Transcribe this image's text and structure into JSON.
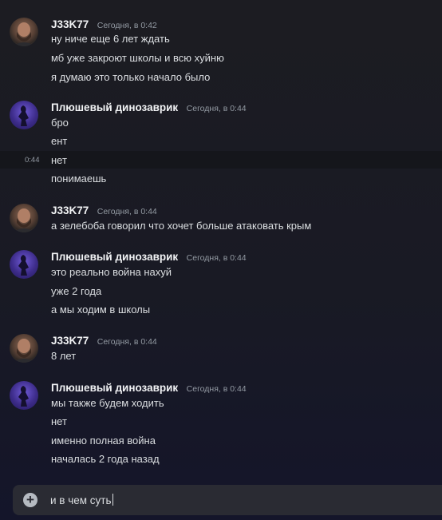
{
  "messages": [
    {
      "author": "J33K77",
      "timestamp": "Сегодня, в 0:42",
      "avatar": "bearded-man-avatar",
      "lines": [
        "ну ниче еще 6 лет ждать",
        "мб уже закроют школы и всю хуйню",
        "я думаю это только начало было"
      ]
    },
    {
      "author": "Плюшевый динозаврик",
      "timestamp": "Сегодня, в 0:44",
      "avatar": "purple-silhouette-avatar",
      "lines": [
        "бро",
        "ент",
        "нет",
        "понимаешь"
      ],
      "hovered_line_time": "0:44"
    },
    {
      "author": "J33K77",
      "timestamp": "Сегодня, в 0:44",
      "avatar": "bearded-man-avatar",
      "lines": [
        "а зелебоба говорил что хочет больше атаковать крым"
      ]
    },
    {
      "author": "Плюшевый динозаврик",
      "timestamp": "Сегодня, в 0:44",
      "avatar": "purple-silhouette-avatar",
      "lines": [
        "это реально война нахуй",
        "уже 2 года",
        "а мы ходим в школы"
      ]
    },
    {
      "author": "J33K77",
      "timestamp": "Сегодня, в 0:44",
      "avatar": "bearded-man-avatar",
      "lines": [
        "8 лет"
      ]
    },
    {
      "author": "Плюшевый динозаврик",
      "timestamp": "Сегодня, в 0:44",
      "avatar": "purple-silhouette-avatar",
      "lines": [
        "мы также будем ходить",
        "нет",
        "именно полная война",
        "началась 2 года назад"
      ]
    }
  ],
  "composer": {
    "value": "и в чем суть",
    "attach_icon": "plus-circle-icon"
  }
}
